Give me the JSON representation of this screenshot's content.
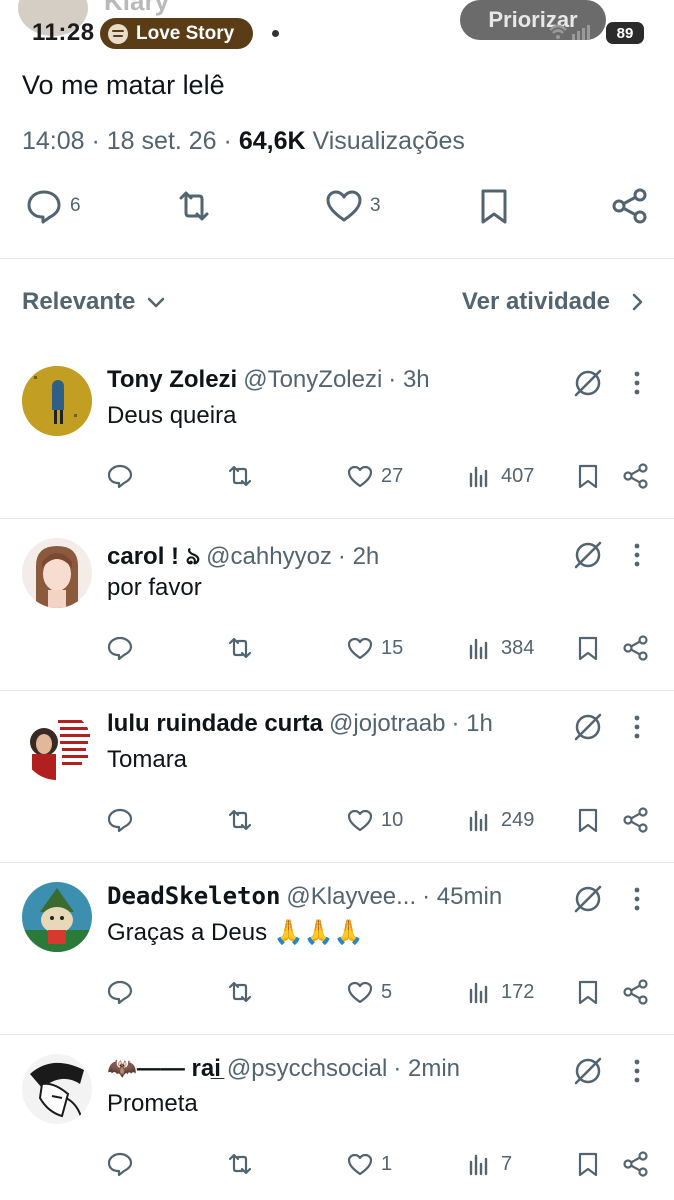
{
  "status_bar": {
    "time": "11:28",
    "faded_name": "Klary",
    "now_playing": "Love Story",
    "priority_label": "Priorizar",
    "battery": "89",
    "signal_icon": "wifi-signal-icon"
  },
  "tweet": {
    "text": "Vo me matar lelê",
    "time": "14:08",
    "date": "18 set. 26",
    "views_count": "64,6K",
    "views_label": "Visualizações",
    "replies": "6",
    "likes": "3"
  },
  "sort": {
    "label": "Relevante",
    "activity_label": "Ver atividade"
  },
  "replies": [
    {
      "name": "Tony Zolezi",
      "handle": "@TonyZolezi",
      "time": "· 3h",
      "text": "Deus queira",
      "likes": "27",
      "views": "407"
    },
    {
      "name": "carol ! ঌ",
      "handle": "@cahhyyoz",
      "time": "· 2h",
      "text": "por favor",
      "likes": "15",
      "views": "384"
    },
    {
      "name": "lulu ruindade curta",
      "handle": "@jojotraab",
      "time": "· 1h",
      "text": "Tomara",
      "likes": "10",
      "views": "249"
    },
    {
      "name": "DeadSkeleton",
      "handle": "@Klayvee...",
      "time": "· 45min",
      "text": "Graças a Deus 🙏🙏🙏",
      "likes": "5",
      "views": "172"
    },
    {
      "name": "🦇—— rai̲",
      "handle": "@psycchsocial",
      "time": "· 2min",
      "text": "Prometa",
      "likes": "1",
      "views": "7"
    }
  ],
  "colors": {
    "text": "#0f1419",
    "secondary": "#536471",
    "divider": "#e6e9eb",
    "pill": "#5a3d17"
  }
}
